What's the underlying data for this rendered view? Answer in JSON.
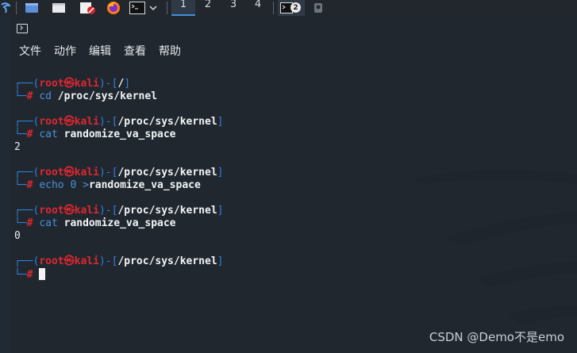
{
  "taskbar": {
    "workspaces": [
      "1",
      "2",
      "3",
      "4"
    ],
    "active_workspace": 0,
    "terminal_badge": "2"
  },
  "menu": [
    "文件",
    "动作",
    "编辑",
    "查看",
    "帮助"
  ],
  "prompt": {
    "user": "root",
    "symbol": "㉿",
    "host": "kali",
    "hash": "#"
  },
  "terminal": {
    "blocks": [
      {
        "path": "/",
        "cmd": "cd",
        "args": "/proc/sys/kernel",
        "output": ""
      },
      {
        "path": "/proc/sys/kernel",
        "cmd": "cat",
        "args": "randomize_va_space",
        "output": "2"
      },
      {
        "path": "/proc/sys/kernel",
        "cmd": "echo",
        "args_pre": "0",
        "redirect": ">",
        "args": "randomize_va_space",
        "output": ""
      },
      {
        "path": "/proc/sys/kernel",
        "cmd": "cat",
        "args": "randomize_va_space",
        "output": "0"
      },
      {
        "path": "/proc/sys/kernel",
        "cmd": "",
        "args": "",
        "output": ""
      }
    ]
  },
  "watermark": "CSDN @Demo不是emo",
  "colors": {
    "prompt_frame": "#2f80d8",
    "prompt_user": "#e02730",
    "accent": "#3d8ee0"
  }
}
